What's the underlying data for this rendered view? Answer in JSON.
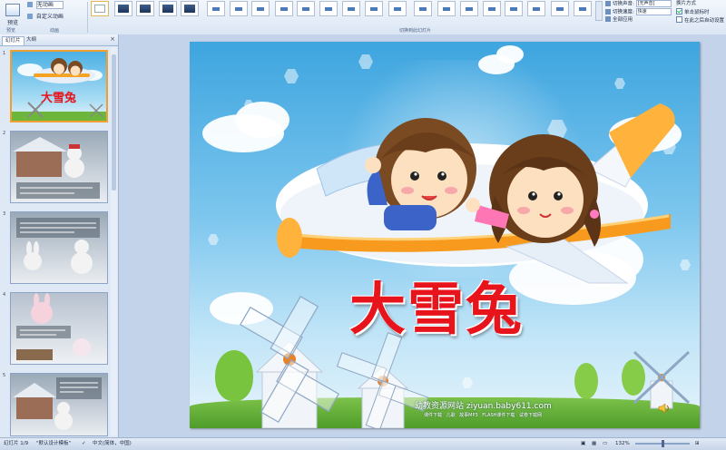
{
  "ribbon": {
    "preview_label": "预览",
    "preview_group": "预览",
    "animation_select": "无动画",
    "custom_animation": "自定义动画",
    "animation_group": "动画",
    "transitions_group": "切换到此幻灯片",
    "sound_label": "切换声音:",
    "sound_value": "[无声音]",
    "speed_label": "切换速度:",
    "speed_value": "快速",
    "apply_all": "全部应用",
    "advance_label": "换片方式",
    "on_click": "单击鼠标时",
    "after_time": "在此之后自动设置"
  },
  "left_pane": {
    "tab_slides": "幻灯片",
    "tab_outline": "大纲",
    "close": "×",
    "thumbs": [
      {
        "num": "1",
        "title": "大雪兔"
      },
      {
        "num": "2"
      },
      {
        "num": "3"
      },
      {
        "num": "4"
      },
      {
        "num": "5"
      }
    ]
  },
  "slide": {
    "title": "大雪兔",
    "site": "幼教资源网站 ziyuan.baby611.com",
    "sub_links": "课件下载  儿歌  故事MP3  FLASH课件下载  试卷下载网"
  },
  "status": {
    "slide_count": "幻灯片 1/9",
    "theme": "\"默认设计模板\"",
    "language": "中文(简体，中国)",
    "zoom": "132%"
  },
  "colors": {
    "title_red": "#e8141c",
    "sky_blue": "#3ea5df",
    "selection_orange": "#f0a030"
  }
}
